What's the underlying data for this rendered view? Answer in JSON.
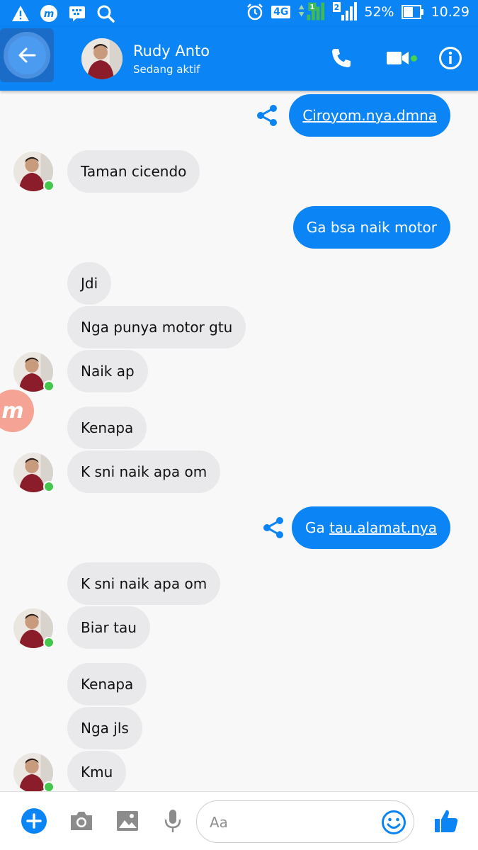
{
  "status_bar": {
    "network": "4G",
    "sim": "2",
    "battery": "52%",
    "time": "10.29"
  },
  "header": {
    "name": "Rudy Anto",
    "status": "Sedang aktif"
  },
  "messages": [
    {
      "from": "me",
      "text": "Ciroyom.nya.dmna",
      "link": true
    },
    {
      "from": "them",
      "text": "Taman cicendo"
    },
    {
      "from": "me",
      "text": "Ga bsa naik motor"
    },
    {
      "from": "them",
      "text": "Jdi"
    },
    {
      "from": "them",
      "text": "Nga punya motor gtu"
    },
    {
      "from": "them",
      "text": "Naik ap"
    },
    {
      "from": "them",
      "text": "Kenapa"
    },
    {
      "from": "them",
      "text": "K sni naik apa om"
    },
    {
      "from": "me",
      "prefix": "Ga",
      "link_text": "tau.alamat.nya"
    },
    {
      "from": "them",
      "text": "K sni naik apa om"
    },
    {
      "from": "them",
      "text": "Biar tau"
    },
    {
      "from": "them",
      "text": "Kenapa"
    },
    {
      "from": "them",
      "text": "Nga jls"
    },
    {
      "from": "them",
      "text": "Kmu"
    }
  ],
  "composer": {
    "placeholder": "Aa"
  },
  "colors": {
    "brand": "#0b84f5",
    "incoming": "#e9e9eb",
    "online": "#43c84d"
  },
  "icons": [
    "warning-icon",
    "messenger-icon",
    "bbm-icon",
    "search-icon",
    "alarm-icon",
    "signal-icon",
    "battery-icon",
    "back-arrow-icon",
    "phone-icon",
    "video-icon",
    "info-icon",
    "share-icon",
    "plus-icon",
    "camera-icon",
    "image-icon",
    "mic-icon",
    "emoji-icon",
    "thumbs-up-icon"
  ]
}
